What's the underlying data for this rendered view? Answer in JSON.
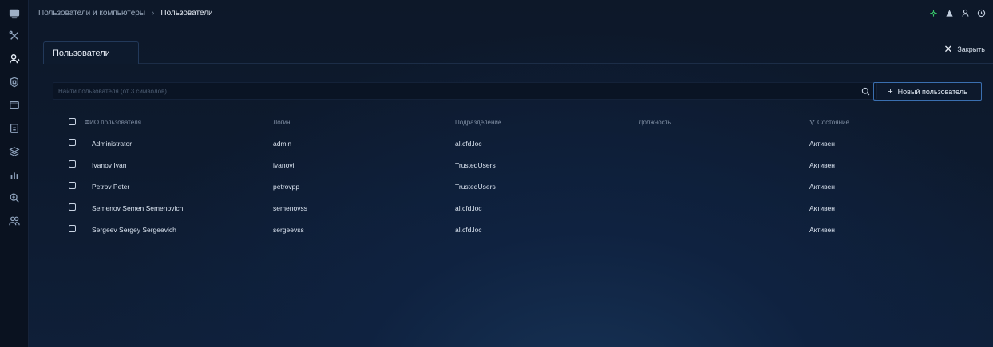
{
  "sidebar": {
    "items": [
      {
        "icon": "app-logo-icon"
      },
      {
        "icon": "tools-icon"
      },
      {
        "icon": "user-icon",
        "active": true
      },
      {
        "icon": "badge-icon"
      },
      {
        "icon": "window-icon"
      },
      {
        "icon": "document-icon"
      },
      {
        "icon": "layers-icon"
      },
      {
        "icon": "bar-chart-icon"
      },
      {
        "icon": "zoom-icon"
      },
      {
        "icon": "users-icon"
      }
    ]
  },
  "breadcrumb": {
    "parent": "Пользователи и компьютеры",
    "separator": "›",
    "current": "Пользователи"
  },
  "topbar": {
    "icons": [
      "network-icon",
      "user-alert-icon",
      "profile-icon",
      "help-icon"
    ]
  },
  "tab": {
    "label": "Пользователи"
  },
  "close": {
    "label": "Закрыть"
  },
  "search": {
    "placeholder": "Найти пользователя (от 3 символов)",
    "value": ""
  },
  "new_user_button": {
    "label": "Новый пользователь"
  },
  "table": {
    "headers": {
      "fio": "ФИО пользователя",
      "login": "Логин",
      "dept": "Подразделение",
      "position": "Должность",
      "state": "Состояние"
    },
    "rows": [
      {
        "fio": "Administrator",
        "login": "admin",
        "dept": "al.cfd.loc",
        "position": "",
        "state": "Активен"
      },
      {
        "fio": "Ivanov Ivan",
        "login": "ivanovi",
        "dept": "TrustedUsers",
        "position": "",
        "state": "Активен"
      },
      {
        "fio": "Petrov Peter",
        "login": "petrovpp",
        "dept": "TrustedUsers",
        "position": "",
        "state": "Активен"
      },
      {
        "fio": "Semenov Semen Semenovich",
        "login": "semenovss",
        "dept": "al.cfd.loc",
        "position": "",
        "state": "Активен"
      },
      {
        "fio": "Sergeev Sergey Sergeevich",
        "login": "sergeevss",
        "dept": "al.cfd.loc",
        "position": "",
        "state": "Активен"
      }
    ]
  },
  "colors": {
    "accent": "#3a6fb0",
    "header_divider": "#1f6aa8",
    "network_status": "#37c46a"
  }
}
